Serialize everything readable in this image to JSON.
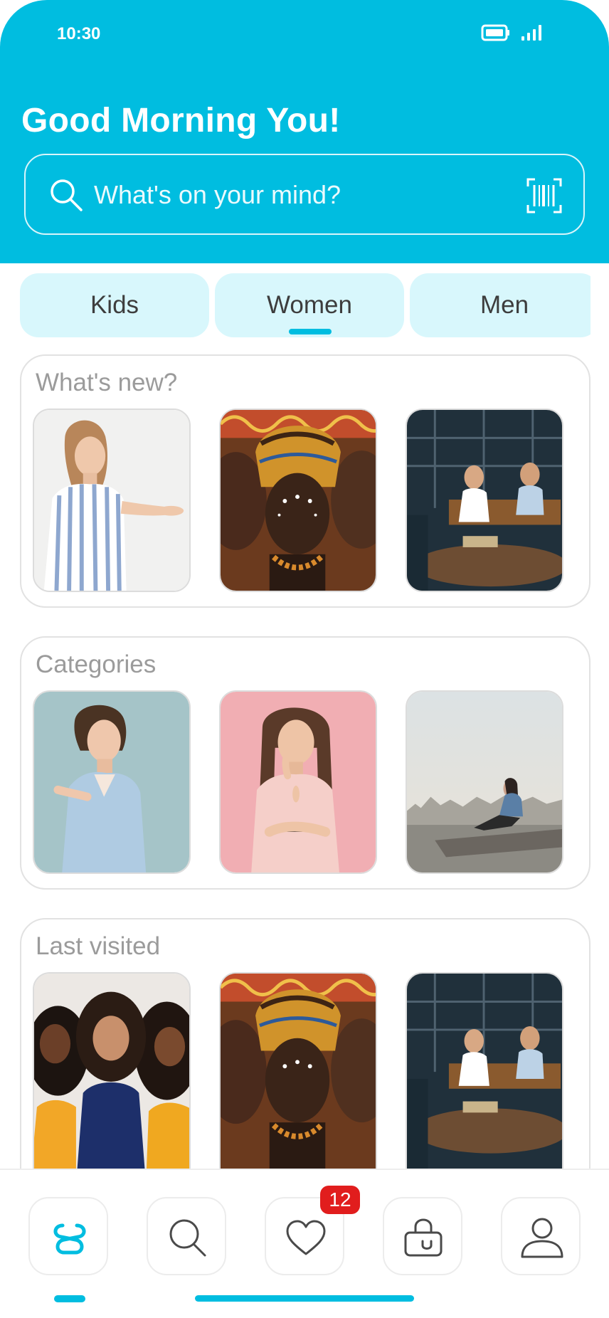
{
  "status_bar": {
    "time": "10:30"
  },
  "header": {
    "greeting": "Good Morning You!",
    "search_placeholder": "What's on your mind?"
  },
  "tabs": [
    {
      "label": "Kids",
      "active": false
    },
    {
      "label": "Women",
      "active": true
    },
    {
      "label": "Men",
      "active": false
    }
  ],
  "sections": [
    {
      "title": "What's new?"
    },
    {
      "title": "Categories"
    },
    {
      "title": "Last visited"
    }
  ],
  "bottom_nav": {
    "items": [
      "logo-icon",
      "search-icon",
      "heart-icon",
      "shopping-bag-icon",
      "user-icon"
    ],
    "favorites_badge": "12"
  },
  "colors": {
    "accent": "#00bde0",
    "tab_background": "#d8f7fc",
    "badge": "#e11d1d",
    "section_title": "#9b9b9b"
  }
}
